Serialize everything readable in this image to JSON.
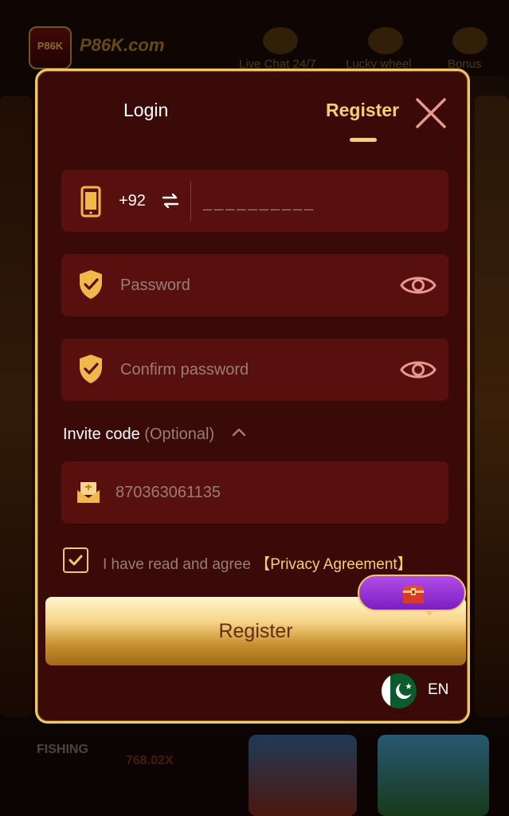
{
  "background": {
    "logo_badge": "P86K",
    "logo_text": "P86K.com",
    "nav": [
      "Live Chat 24/7",
      "Lucky wheel",
      "Bonus"
    ],
    "fishing_label": "FISHING",
    "multiplier": "768.02X"
  },
  "modal": {
    "tabs": {
      "login": "Login",
      "register": "Register"
    },
    "phone": {
      "country_code": "+92",
      "placeholder": "__________"
    },
    "password": {
      "placeholder": "Password"
    },
    "confirm_password": {
      "placeholder": "Confirm password"
    },
    "invite": {
      "label": "Invite code",
      "optional": "(Optional)",
      "value": "870363061135"
    },
    "agreement": {
      "text": "I have read and agree",
      "link": "【Privacy Agreement】",
      "checked": true
    },
    "register_button": "Register",
    "language": "EN"
  },
  "colors": {
    "accent": "#f6cf74",
    "field_bg": "#57100e",
    "modal_bg": "#3a0a08",
    "border": "#f0c86a"
  }
}
